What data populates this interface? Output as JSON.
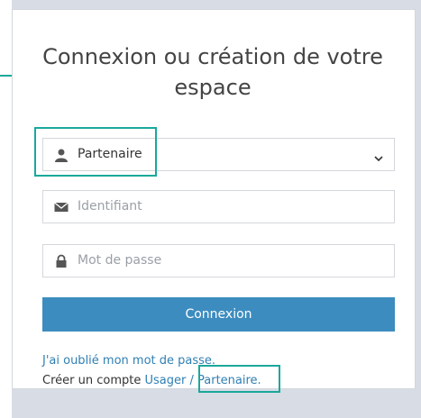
{
  "title": "Connexion ou création de votre espace",
  "select": {
    "selected": "Partenaire",
    "icon": "user-icon"
  },
  "identifiant": {
    "placeholder": "Identifiant",
    "icon": "envelope-icon"
  },
  "password": {
    "placeholder": "Mot de passe",
    "icon": "lock-icon"
  },
  "login_button": "Connexion",
  "forgot_link": "J'ai oublié mon mot de passe.",
  "create": {
    "prefix": "Créer un compte",
    "usager": "Usager",
    "separator": " / ",
    "partenaire": "Partenaire."
  },
  "colors": {
    "accent": "#1aa89a",
    "button": "#3d8cbf",
    "link": "#2f7fb3"
  }
}
